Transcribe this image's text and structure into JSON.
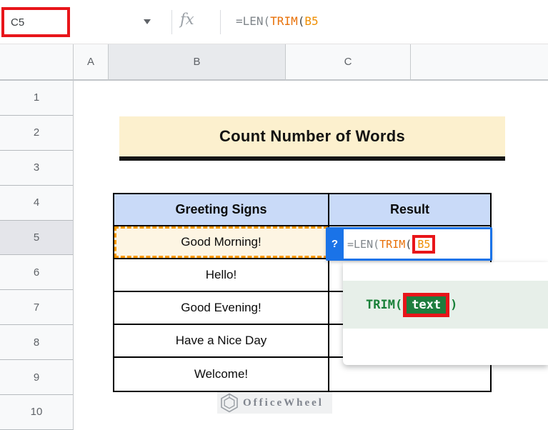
{
  "topbar": {
    "name_box_value": "C5",
    "fx_label": "fx"
  },
  "formula": {
    "prefix": "=LEN(",
    "func": "TRIM",
    "paren": "(",
    "ref": "B5"
  },
  "column_headers": [
    "A",
    "B",
    "C"
  ],
  "row_numbers": [
    "1",
    "2",
    "3",
    "4",
    "5",
    "6",
    "7",
    "8",
    "9",
    "10"
  ],
  "title": "Count Number of Words",
  "table": {
    "headers": [
      "Greeting Signs",
      "Result"
    ],
    "b5_value": "Good Morning!",
    "rows": [
      "Hello!",
      "Good Evening!",
      "Have a Nice Day",
      "Welcome!"
    ]
  },
  "editor": {
    "help_badge": "?"
  },
  "tooltip": {
    "func": "TRIM(",
    "param": "text",
    "close": ")"
  },
  "watermark": "OfficeWheel",
  "colors": {
    "annotation_red": "#e8151a",
    "editor_blue": "#1a73e8",
    "reference_orange": "#ef8e00",
    "function_orange": "#e8710a",
    "formula_gray": "#80868b",
    "func_green": "#188038",
    "param_pill_green": "#1e7d3e",
    "tooltip_bg_green": "#e7efe9",
    "table_header_blue": "#c9daf8",
    "title_cream": "#fcf0ce",
    "b5_cream": "#fdf5e3",
    "marching_ants_orange": "#ff9800"
  }
}
